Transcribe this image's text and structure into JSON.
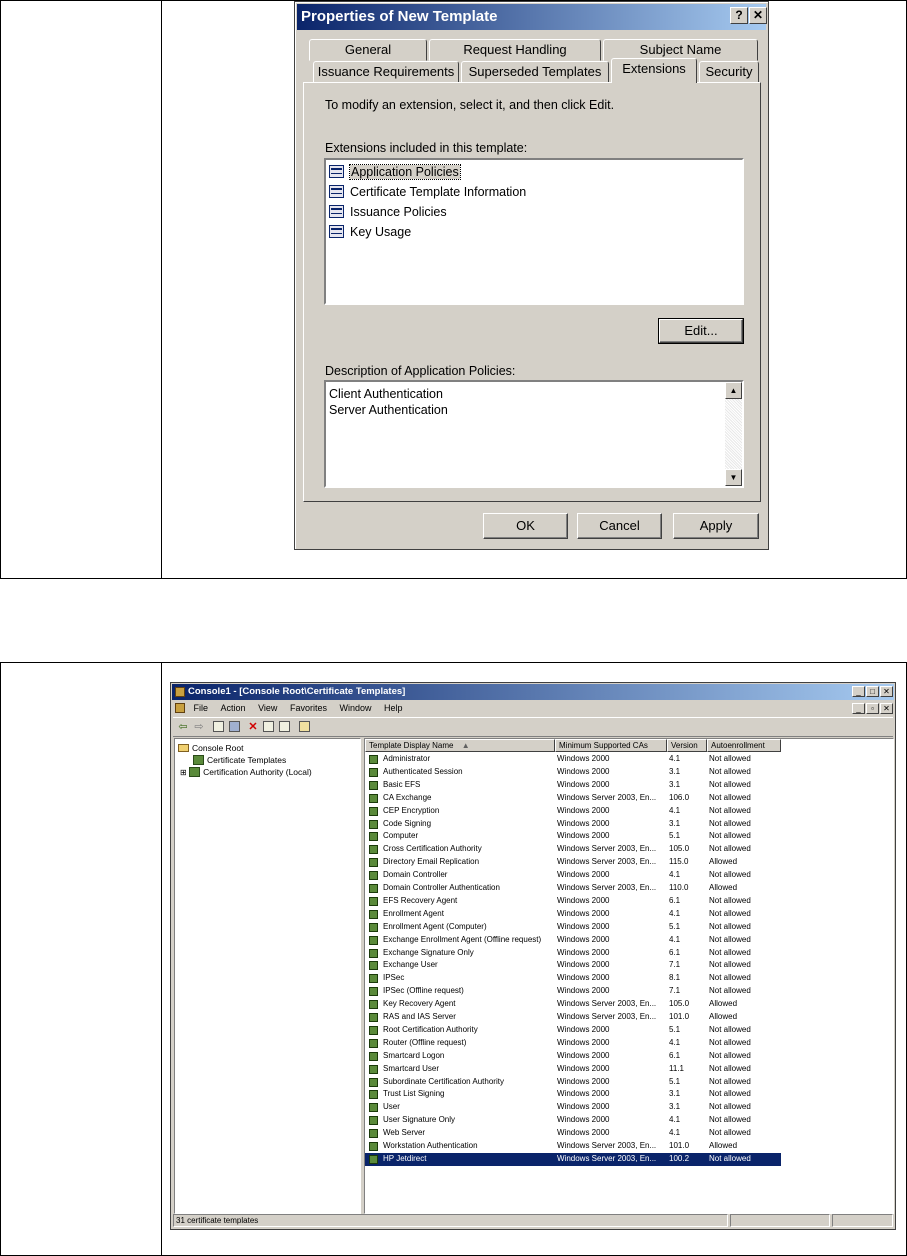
{
  "dialog": {
    "title": "Properties of New Template",
    "help_label": "?",
    "close_label": "✕",
    "tabs_back": [
      "General",
      "Request Handling",
      "Subject Name"
    ],
    "tabs_front": [
      "Issuance Requirements",
      "Superseded Templates",
      "Extensions",
      "Security"
    ],
    "instruction": "To modify an extension, select it, and then click Edit.",
    "extensions_label": "Extensions included in this template:",
    "extensions": [
      "Application Policies",
      "Certificate Template Information",
      "Issuance Policies",
      "Key Usage"
    ],
    "edit_label": "Edit...",
    "description_label": "Description of Application Policies:",
    "description_lines": [
      "Client Authentication",
      "Server Authentication"
    ],
    "ok_label": "OK",
    "cancel_label": "Cancel",
    "apply_label": "Apply"
  },
  "mmc": {
    "title": "Console1 - [Console Root\\Certificate Templates]",
    "menu": [
      "File",
      "Action",
      "View",
      "Favorites",
      "Window",
      "Help"
    ],
    "tree": {
      "root": "Console Root",
      "item1": "Certificate Templates",
      "item2": "Certification Authority (Local)"
    },
    "columns": [
      "Template Display Name",
      "Minimum Supported CAs",
      "Version",
      "Autoenrollment"
    ],
    "rows": [
      [
        "Administrator",
        "Windows 2000",
        "4.1",
        "Not allowed"
      ],
      [
        "Authenticated Session",
        "Windows 2000",
        "3.1",
        "Not allowed"
      ],
      [
        "Basic EFS",
        "Windows 2000",
        "3.1",
        "Not allowed"
      ],
      [
        "CA Exchange",
        "Windows Server 2003, En...",
        "106.0",
        "Not allowed"
      ],
      [
        "CEP Encryption",
        "Windows 2000",
        "4.1",
        "Not allowed"
      ],
      [
        "Code Signing",
        "Windows 2000",
        "3.1",
        "Not allowed"
      ],
      [
        "Computer",
        "Windows 2000",
        "5.1",
        "Not allowed"
      ],
      [
        "Cross Certification Authority",
        "Windows Server 2003, En...",
        "105.0",
        "Not allowed"
      ],
      [
        "Directory Email Replication",
        "Windows Server 2003, En...",
        "115.0",
        "Allowed"
      ],
      [
        "Domain Controller",
        "Windows 2000",
        "4.1",
        "Not allowed"
      ],
      [
        "Domain Controller Authentication",
        "Windows Server 2003, En...",
        "110.0",
        "Allowed"
      ],
      [
        "EFS Recovery Agent",
        "Windows 2000",
        "6.1",
        "Not allowed"
      ],
      [
        "Enrollment Agent",
        "Windows 2000",
        "4.1",
        "Not allowed"
      ],
      [
        "Enrollment Agent (Computer)",
        "Windows 2000",
        "5.1",
        "Not allowed"
      ],
      [
        "Exchange Enrollment Agent (Offline request)",
        "Windows 2000",
        "4.1",
        "Not allowed"
      ],
      [
        "Exchange Signature Only",
        "Windows 2000",
        "6.1",
        "Not allowed"
      ],
      [
        "Exchange User",
        "Windows 2000",
        "7.1",
        "Not allowed"
      ],
      [
        "IPSec",
        "Windows 2000",
        "8.1",
        "Not allowed"
      ],
      [
        "IPSec (Offline request)",
        "Windows 2000",
        "7.1",
        "Not allowed"
      ],
      [
        "Key Recovery Agent",
        "Windows Server 2003, En...",
        "105.0",
        "Allowed"
      ],
      [
        "RAS and IAS Server",
        "Windows Server 2003, En...",
        "101.0",
        "Allowed"
      ],
      [
        "Root Certification Authority",
        "Windows 2000",
        "5.1",
        "Not allowed"
      ],
      [
        "Router (Offline request)",
        "Windows 2000",
        "4.1",
        "Not allowed"
      ],
      [
        "Smartcard Logon",
        "Windows 2000",
        "6.1",
        "Not allowed"
      ],
      [
        "Smartcard User",
        "Windows 2000",
        "11.1",
        "Not allowed"
      ],
      [
        "Subordinate Certification Authority",
        "Windows 2000",
        "5.1",
        "Not allowed"
      ],
      [
        "Trust List Signing",
        "Windows 2000",
        "3.1",
        "Not allowed"
      ],
      [
        "User",
        "Windows 2000",
        "3.1",
        "Not allowed"
      ],
      [
        "User Signature Only",
        "Windows 2000",
        "4.1",
        "Not allowed"
      ],
      [
        "Web Server",
        "Windows 2000",
        "4.1",
        "Not allowed"
      ],
      [
        "Workstation Authentication",
        "Windows Server 2003, En...",
        "101.0",
        "Allowed"
      ],
      [
        "HP Jetdirect",
        "Windows Server 2003, En...",
        "100.2",
        "Not allowed"
      ]
    ],
    "selected_row": 31,
    "status": "31 certificate templates"
  }
}
